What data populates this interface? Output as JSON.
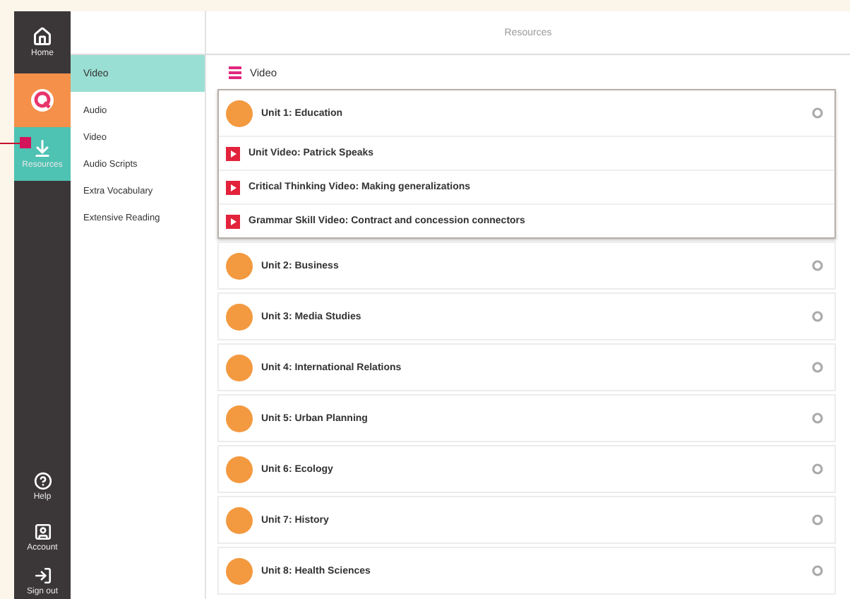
{
  "rail": {
    "items": [
      {
        "kind": "nav",
        "label": "Home",
        "selected": false
      },
      {
        "kind": "logo"
      },
      {
        "kind": "nav",
        "label": "Resources",
        "selected": true
      }
    ],
    "bottom_items": [
      {
        "label": "Help"
      },
      {
        "label": "Account"
      },
      {
        "label": "Sign out"
      }
    ]
  },
  "submenu": {
    "heading": "Video",
    "items": [
      "Audio",
      "Video",
      "Audio Scripts",
      "Extra Vocabulary",
      "Extensive Reading"
    ]
  },
  "header": {
    "title": "Resources"
  },
  "content": {
    "title": "Video",
    "units": [
      {
        "title": "Unit 1: Education",
        "expanded": true,
        "videos": [
          "Unit Video: Patrick Speaks",
          "Critical Thinking Video: Making generalizations",
          "Grammar Skill Video: Contract and concession connectors"
        ]
      },
      {
        "title": "Unit 2: Business",
        "expanded": false
      },
      {
        "title": "Unit 3: Media Studies",
        "expanded": false
      },
      {
        "title": "Unit 4: International Relations",
        "expanded": false
      },
      {
        "title": "Unit 5: Urban Planning",
        "expanded": false
      },
      {
        "title": "Unit 6: Ecology",
        "expanded": false
      },
      {
        "title": "Unit 7: History",
        "expanded": false
      },
      {
        "title": "Unit 8: Health Sciences",
        "expanded": false
      }
    ]
  }
}
